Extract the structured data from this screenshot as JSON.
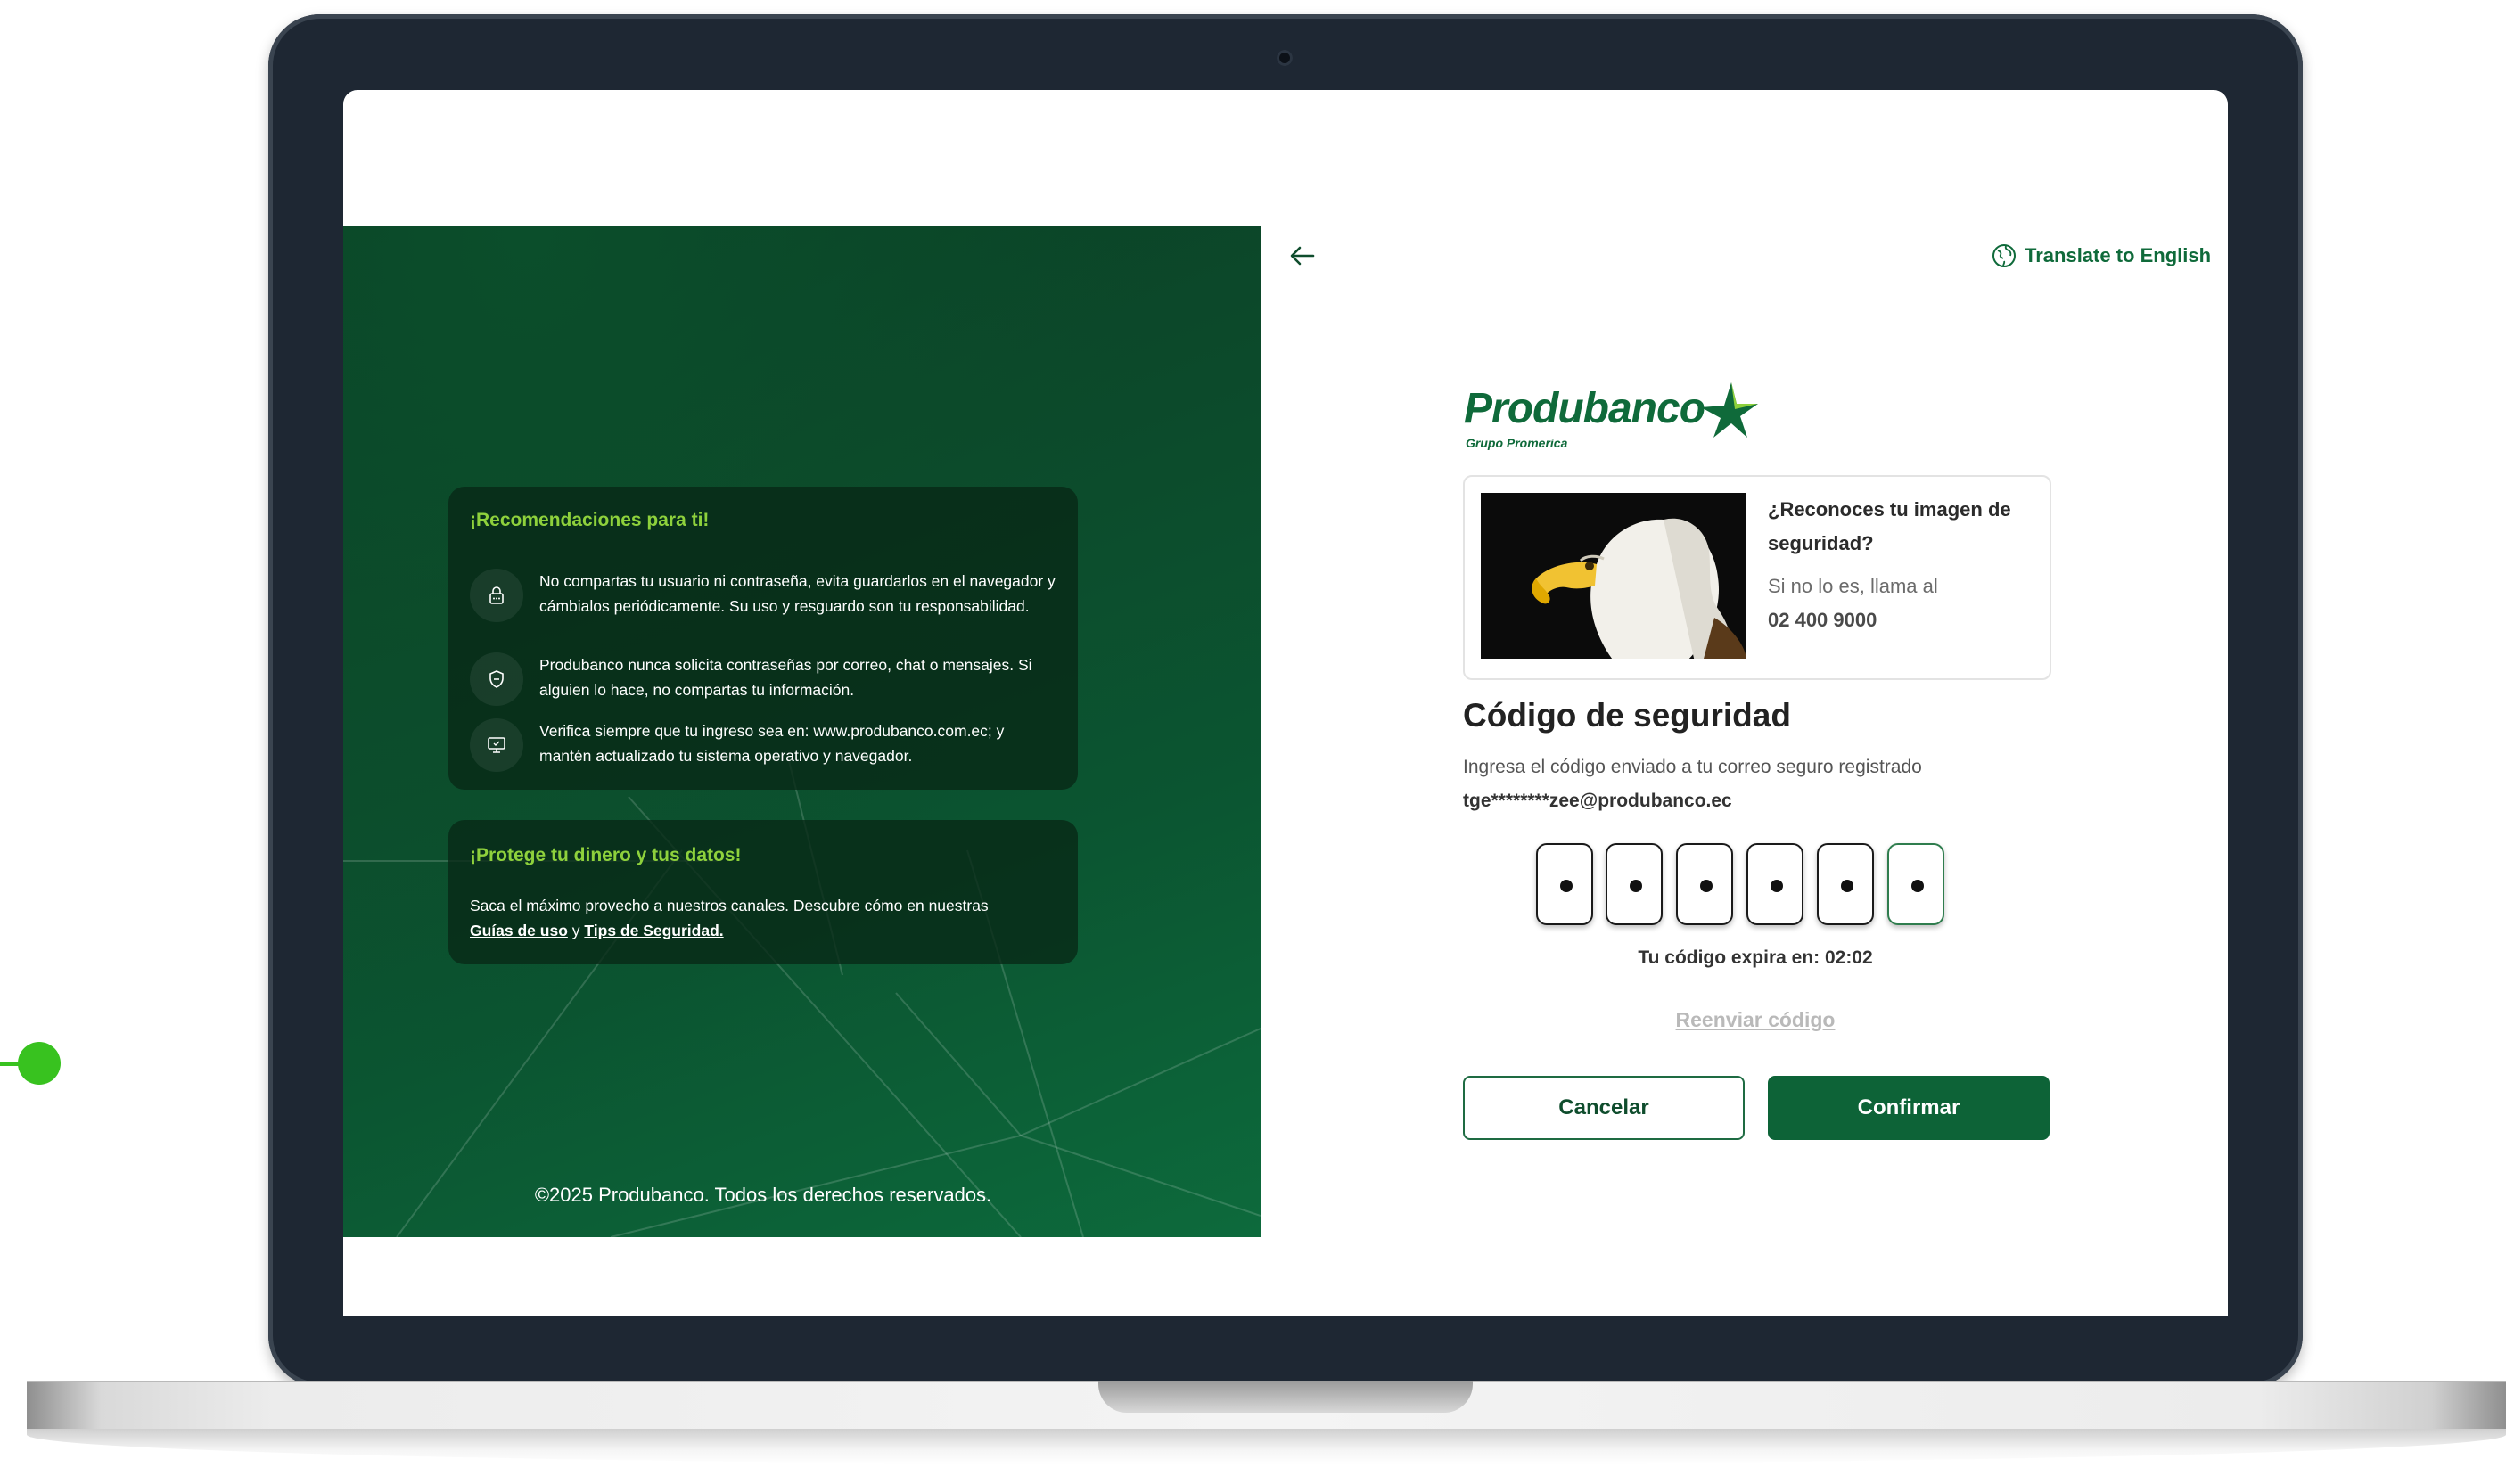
{
  "left_panel": {
    "recommendations": {
      "title": "¡Recomendaciones para ti!",
      "items": [
        {
          "icon": "lock-icon",
          "text": "No compartas tu usuario ni contraseña, evita guardarlos en el navegador y cámbialos periódicamente. Su uso y resguardo son tu responsabilidad."
        },
        {
          "icon": "shield-icon",
          "text": "Produbanco nunca solicita contraseñas por correo, chat o mensajes. Si alguien lo hace, no compartas tu información."
        },
        {
          "icon": "monitor-icon",
          "text": "Verifica siempre que tu ingreso sea en: www.produbanco.com.ec; y mantén actualizado tu sistema operativo y navegador."
        }
      ]
    },
    "protect": {
      "title": "¡Protege tu dinero y tus datos!",
      "text_before": "Saca el máximo provecho a nuestros canales. Descubre cómo en nuestras",
      "link_guides": "Guías de uso",
      "connector": "y",
      "link_tips": "Tips de Seguridad."
    },
    "copyright": "©2025 Produbanco. Todos los derechos reservados."
  },
  "header": {
    "back_icon": "arrow-left-icon",
    "translate_icon": "globe-icon",
    "translate_label": "Translate to English"
  },
  "logo": {
    "name": "Produbanco",
    "subtitle": "Grupo Promerica"
  },
  "security_image": {
    "question": "¿Reconoces tu imagen de seguridad?",
    "hint": "Si no lo es, llama al",
    "phone": "02 400 9000"
  },
  "security_code": {
    "title": "Código de seguridad",
    "description": "Ingresa el código enviado a tu correo seguro registrado",
    "email": "tge********zee@produbanco.ec",
    "digits_filled": 6,
    "expires_label": "Tu código expira en: 02:02",
    "resend_label": "Reenviar código"
  },
  "actions": {
    "cancel_label": "Cancelar",
    "confirm_label": "Confirmar"
  },
  "colors": {
    "brand_green": "#0d6337",
    "accent_green": "#8ed13c",
    "frame_dark": "#1e2733"
  }
}
